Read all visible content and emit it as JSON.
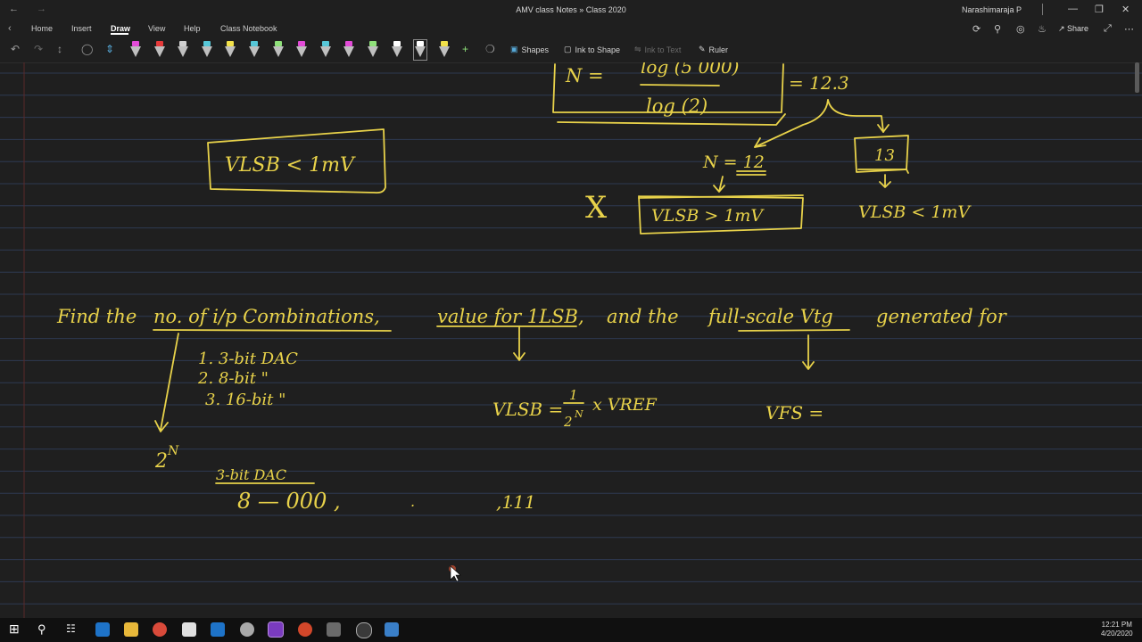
{
  "window": {
    "title": "AMV class Notes » Class 2020",
    "user": "Narashimaraja P",
    "back": "←",
    "forward": "→"
  },
  "ribbon": {
    "tabs": [
      "Home",
      "Insert",
      "Draw",
      "View",
      "Help",
      "Class Notebook"
    ],
    "active_tab": "Draw",
    "share_label": "Share"
  },
  "toolbar": {
    "shapes_label": "Shapes",
    "ink_to_shape_label": "Ink to Shape",
    "ink_to_text_label": "Ink to Text",
    "ruler_label": "Ruler",
    "pen_colors": [
      "#e24bd7",
      "#e63a3a",
      "#cfcfcf",
      "#57c7d8",
      "#f2e14a",
      "#57c7d8",
      "#8fe07a",
      "#e24bd7",
      "#57c7d8",
      "#e24bd7",
      "#8fe07a",
      "#ffffff",
      "#ffffff",
      "#f2e14a"
    ]
  },
  "notes": {
    "ink_color": "#e8d24a",
    "top_formula": {
      "lhs": "N =",
      "numerator": "log (5 000)",
      "denominator": "log (2)",
      "result": "= 12.3"
    },
    "left_box": "VLSB < 1mV",
    "n12": "N = 12",
    "cross": "X",
    "box12": "VLSB > 1mV",
    "box13": "13",
    "right_note": "VLSB < 1mV",
    "question": {
      "p1": "Find the",
      "p2": "no. of i/p Combinations,",
      "p3": "value for 1LSB,",
      "p4": "and the",
      "p5": "full-scale Vtg",
      "p6": "generated for"
    },
    "list": [
      "1. 3-bit DAC",
      "2. 8-bit \"",
      "3. 16-bit \""
    ],
    "two_n": "2",
    "two_n_sup": "N",
    "three_bit": "3-bit DAC",
    "eight": "8 — 000 ,",
    "dots": ". .",
    "ones": ",111",
    "vlsb_formula": {
      "lhs": "VLSB =",
      "num": "1",
      "den": "2",
      "den_sup": "N",
      "rhs": "x VREF"
    },
    "vfs": "VFS ="
  },
  "taskbar": {
    "time": "12:21 PM",
    "date": "4/20/2020"
  }
}
